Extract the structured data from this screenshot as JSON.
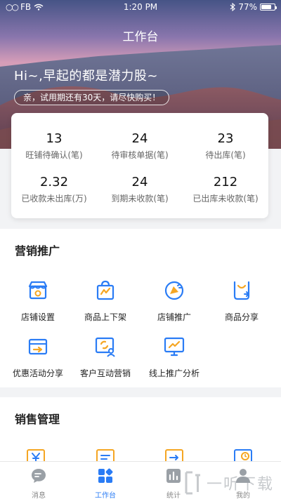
{
  "status_bar": {
    "carrier": "FB",
    "time": "1:20 PM",
    "battery": "77%",
    "battery_level": 0.77
  },
  "header": {
    "title": "工作台",
    "greeting": "Hi~,早起的都是潜力股~",
    "trial_notice": "亲，试用期还有30天，请尽快购买！"
  },
  "stats": [
    {
      "value": "13",
      "label": "旺铺待确认(笔)"
    },
    {
      "value": "24",
      "label": "待审核单据(笔)"
    },
    {
      "value": "23",
      "label": "待出库(笔)"
    },
    {
      "value": "2.32",
      "label": "已收款未出库(万)"
    },
    {
      "value": "24",
      "label": "到期未收款(笔)"
    },
    {
      "value": "212",
      "label": "已出库未收款(笔)"
    }
  ],
  "marketing": {
    "title": "营销推广",
    "items": [
      {
        "label": "店铺设置",
        "icon": "shop-settings-icon"
      },
      {
        "label": "商品上下架",
        "icon": "product-shelf-icon"
      },
      {
        "label": "店铺推广",
        "icon": "shop-promotion-icon"
      },
      {
        "label": "商品分享",
        "icon": "product-share-icon"
      },
      {
        "label": "优惠活动分享",
        "icon": "coupon-share-icon"
      },
      {
        "label": "客户互动营销",
        "icon": "customer-interaction-icon"
      },
      {
        "label": "线上推广分析",
        "icon": "promotion-analytics-icon"
      }
    ]
  },
  "sales": {
    "title": "销售管理"
  },
  "tabbar": [
    {
      "label": "消息",
      "icon": "message-icon",
      "active": false
    },
    {
      "label": "工作台",
      "icon": "workbench-icon",
      "active": true
    },
    {
      "label": "统计",
      "icon": "statistics-icon",
      "active": false
    },
    {
      "label": "我的",
      "icon": "profile-icon",
      "active": false
    }
  ],
  "watermark": {
    "text": "一听下载"
  },
  "colors": {
    "accent": "#2a7cf5",
    "icon_orange": "#f5a623",
    "icon_blue": "#2a7cf5"
  }
}
